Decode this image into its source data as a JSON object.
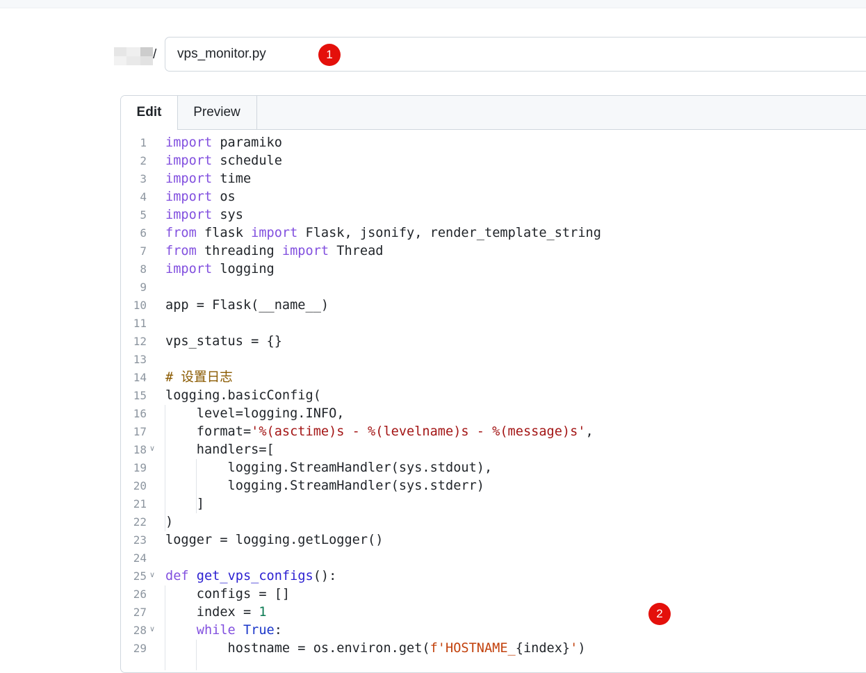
{
  "path": {
    "owner_redacted": "",
    "separator": "/",
    "filename_value": "vps_monitor.py"
  },
  "markers": {
    "m1": "1",
    "m2": "2"
  },
  "tabs": {
    "edit": "Edit",
    "preview": "Preview"
  },
  "code_lines": [
    [
      [
        "kw",
        "import"
      ],
      [
        "t",
        " paramiko"
      ]
    ],
    [
      [
        "kw",
        "import"
      ],
      [
        "t",
        " schedule"
      ]
    ],
    [
      [
        "kw",
        "import"
      ],
      [
        "t",
        " time"
      ]
    ],
    [
      [
        "kw",
        "import"
      ],
      [
        "t",
        " os"
      ]
    ],
    [
      [
        "kw",
        "import"
      ],
      [
        "t",
        " sys"
      ]
    ],
    [
      [
        "kw",
        "from"
      ],
      [
        "t",
        " flask "
      ],
      [
        "kw",
        "import"
      ],
      [
        "t",
        " Flask, jsonify, render_template_string"
      ]
    ],
    [
      [
        "kw",
        "from"
      ],
      [
        "t",
        " threading "
      ],
      [
        "kw",
        "import"
      ],
      [
        "t",
        " Thread"
      ]
    ],
    [
      [
        "kw",
        "import"
      ],
      [
        "t",
        " logging"
      ]
    ],
    [],
    [
      [
        "t",
        "app = Flask(__name__)"
      ]
    ],
    [],
    [
      [
        "t",
        "vps_status = {}"
      ]
    ],
    [],
    [
      [
        "cmt",
        "# 设置日志"
      ]
    ],
    [
      [
        "t",
        "logging.basicConfig("
      ]
    ],
    [
      [
        "t",
        "    level=logging.INFO,"
      ]
    ],
    [
      [
        "t",
        "    format="
      ],
      [
        "str",
        "'%(asctime)s - %(levelname)s - %(message)s'"
      ],
      [
        "t",
        ","
      ]
    ],
    [
      [
        "t",
        "    handlers=["
      ]
    ],
    [
      [
        "t",
        "        logging.StreamHandler(sys.stdout),"
      ]
    ],
    [
      [
        "t",
        "        logging.StreamHandler(sys.stderr)"
      ]
    ],
    [
      [
        "t",
        "    ]"
      ]
    ],
    [
      [
        "t",
        ")"
      ]
    ],
    [
      [
        "t",
        "logger = logging.getLogger()"
      ]
    ],
    [],
    [
      [
        "kw",
        "def"
      ],
      [
        "t",
        " "
      ],
      [
        "fn",
        "get_vps_configs"
      ],
      [
        "t",
        "():"
      ]
    ],
    [
      [
        "t",
        "    configs = []"
      ]
    ],
    [
      [
        "t",
        "    index = "
      ],
      [
        "num",
        "1"
      ]
    ],
    [
      [
        "t",
        "    "
      ],
      [
        "kw",
        "while"
      ],
      [
        "t",
        " "
      ],
      [
        "kwc",
        "True"
      ],
      [
        "t",
        ":"
      ]
    ],
    [
      [
        "t",
        "        hostname = os.environ.get("
      ],
      [
        "fstr",
        "f'HOSTNAME_"
      ],
      [
        "t",
        "{index}"
      ],
      [
        "fstr",
        "'"
      ],
      [
        "t",
        ")"
      ]
    ]
  ],
  "fold_lines": [
    18,
    25,
    28
  ],
  "colors": {
    "keyword": "#8250df",
    "string": "#a31515",
    "comment": "#8a5a00",
    "function": "#2b1fd1",
    "number": "#0a7a52",
    "marker": "#e4100b"
  }
}
